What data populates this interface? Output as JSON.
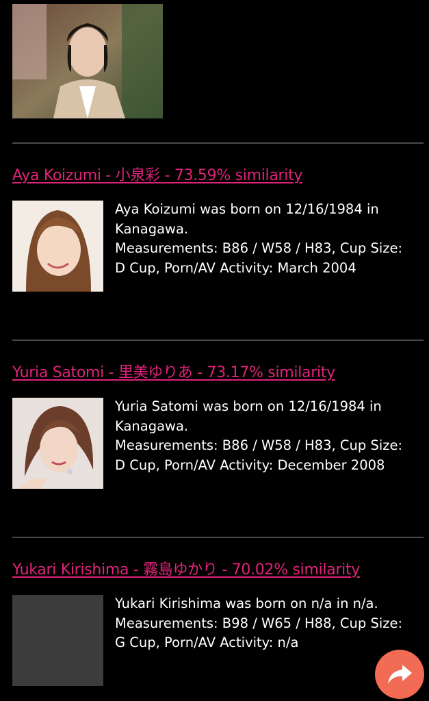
{
  "colors": {
    "background": "#000000",
    "link": "#e0237a",
    "divider": "#4a4a4a",
    "fab": "#f26b55"
  },
  "results": [
    {
      "title": "Aya Koizumi - 小泉彩 - 73.59% similarity",
      "bio_line1": "Aya Koizumi was born on 12/16/1984 in Kanagawa.",
      "bio_line2": "Measurements: B86 / W58 / H83, Cup Size: D Cup, Porn/AV Activity: March 2004",
      "photo_icon": "portrait-photo"
    },
    {
      "title": "Yuria Satomi - 里美ゆりあ - 73.17% similarity",
      "bio_line1": "Yuria Satomi was born on 12/16/1984 in Kanagawa.",
      "bio_line2": "Measurements: B86 / W58 / H83, Cup Size: D Cup, Porn/AV Activity: December 2008",
      "photo_icon": "portrait-photo"
    },
    {
      "title": "Yukari Kirishima - 霧島ゆかり - 70.02% similarity",
      "bio_line1": "Yukari Kirishima was born on n/a in n/a.",
      "bio_line2": "Measurements: B98 / W65 / H88, Cup Size: G Cup, Porn/AV Activity: n/a",
      "photo_icon": "photo-placeholder"
    }
  ],
  "fab": {
    "icon": "share-arrow-icon"
  }
}
